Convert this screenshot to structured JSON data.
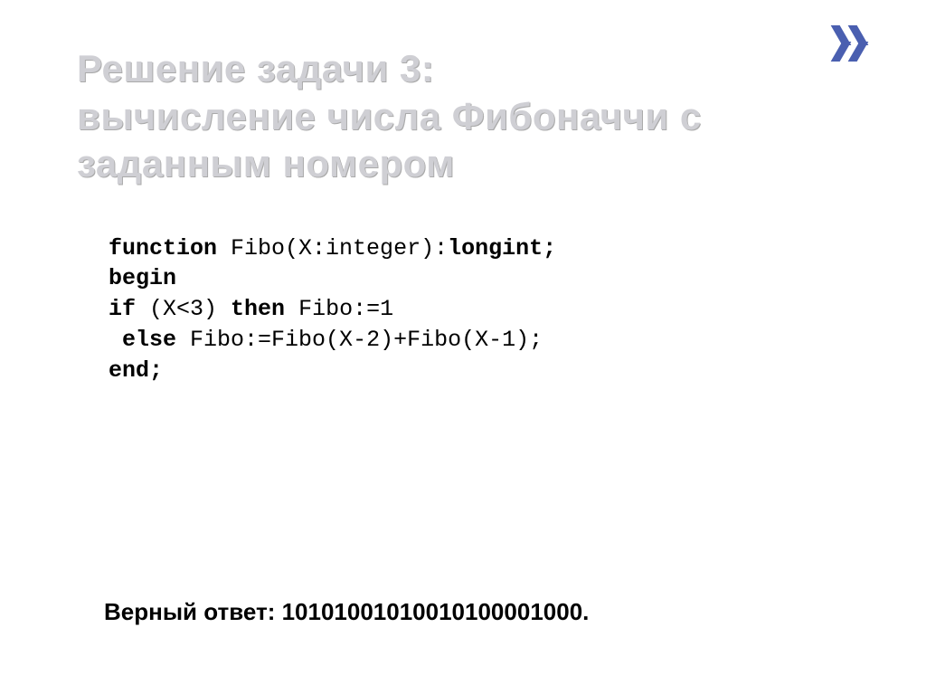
{
  "title": "Решение задачи 3:\nвычисление числа Фибоначчи с заданным номером",
  "code": {
    "l1_kw1": "function",
    "l1_nm1": " Fibo(X:integer):",
    "l1_kw2": "longint;",
    "l2_kw1": "begin",
    "l3_kw1": "if",
    "l3_nm1": " (X<3) ",
    "l3_kw2": "then",
    "l3_nm2": " Fibo:=1",
    "l4_nm1": " ",
    "l4_kw1": "else",
    "l4_nm2": " Fibo:=Fibo(X-2)+Fibo(X-1);",
    "l5_kw1": "end;"
  },
  "answer": "Верный ответ: 10101001010010100001000."
}
